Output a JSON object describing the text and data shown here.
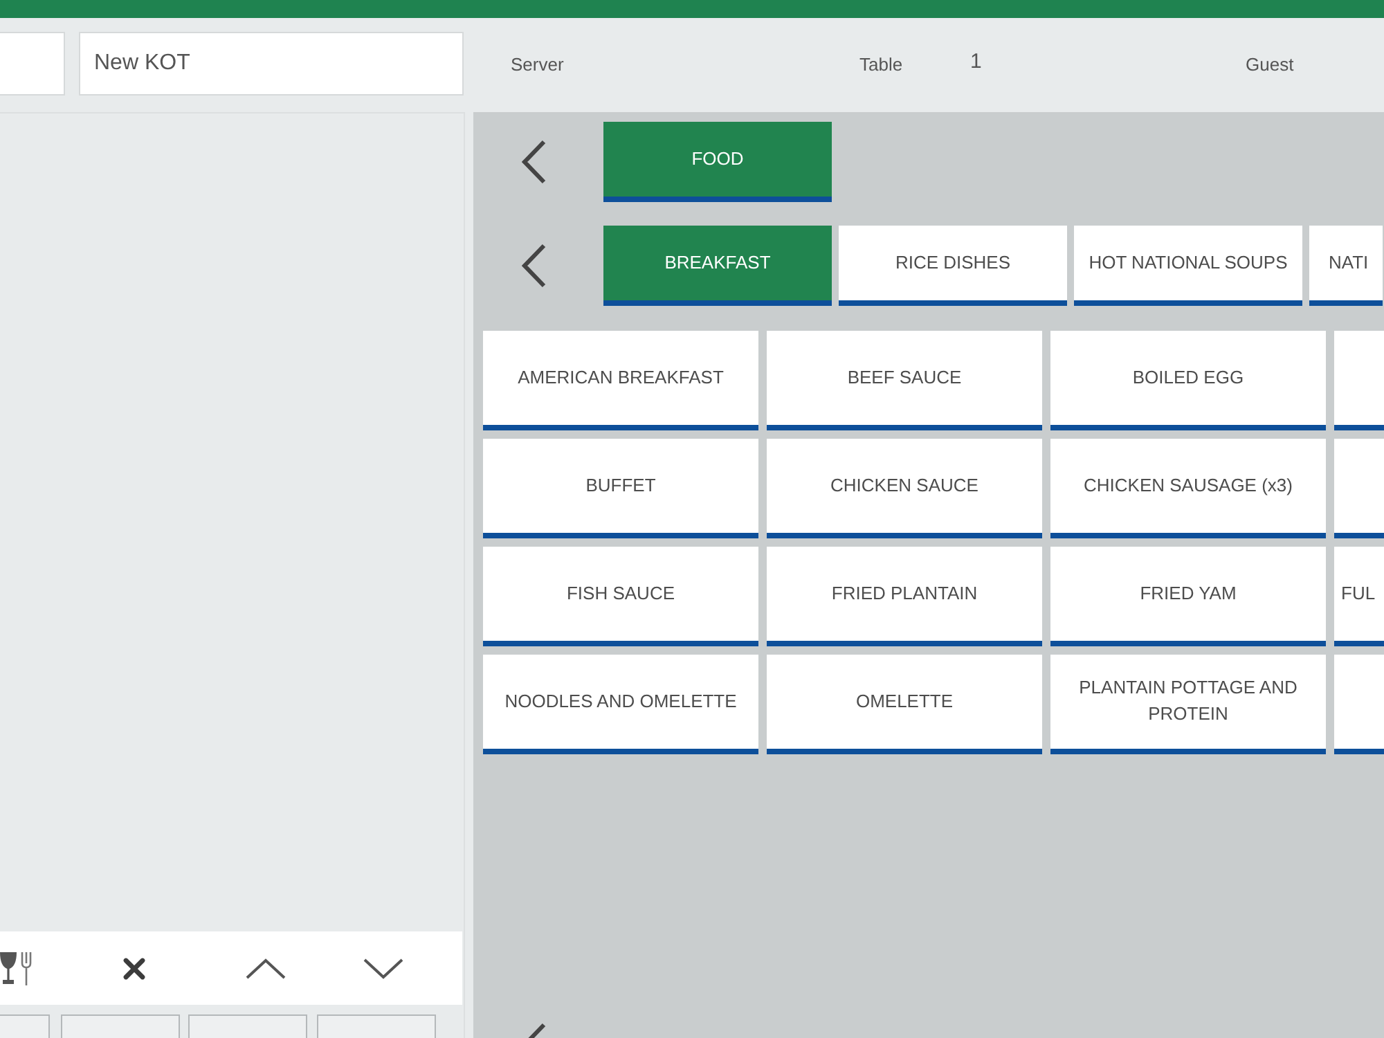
{
  "header": {
    "kot_field": {
      "value": "New KOT"
    },
    "server_label": "Server",
    "table_label": "Table",
    "table_value": "1",
    "guest_label": "Guest"
  },
  "categories": [
    {
      "label": "FOOD",
      "selected": true
    }
  ],
  "subcategories": [
    {
      "label": "BREAKFAST",
      "selected": true,
      "kind": "full"
    },
    {
      "label": "RICE DISHES",
      "selected": false,
      "kind": "full"
    },
    {
      "label": "HOT NATIONAL SOUPS",
      "selected": false,
      "kind": "full"
    },
    {
      "label": "NATI",
      "selected": false,
      "kind": "cut"
    }
  ],
  "items": [
    {
      "label": "AMERICAN BREAKFAST",
      "kind": "full"
    },
    {
      "label": "BEEF SAUCE",
      "kind": "full"
    },
    {
      "label": "BOILED EGG",
      "kind": "full"
    },
    {
      "kind": "cut"
    },
    {
      "label": "BUFFET",
      "kind": "full"
    },
    {
      "label": "CHICKEN SAUCE",
      "kind": "full"
    },
    {
      "label": "CHICKEN SAUSAGE (x3)",
      "kind": "full"
    },
    {
      "kind": "cut"
    },
    {
      "label": "FISH SAUCE",
      "kind": "full"
    },
    {
      "label": "FRIED PLANTAIN",
      "kind": "full"
    },
    {
      "label": "FRIED YAM",
      "kind": "full"
    },
    {
      "label": "FUL",
      "kind": "cut"
    },
    {
      "label": "NOODLES AND OMELETTE",
      "kind": "full"
    },
    {
      "label": "OMELETTE",
      "kind": "full"
    },
    {
      "label": "PLANTAIN POTTAGE AND PROTEIN",
      "kind": "full"
    },
    {
      "kind": "cut"
    }
  ]
}
